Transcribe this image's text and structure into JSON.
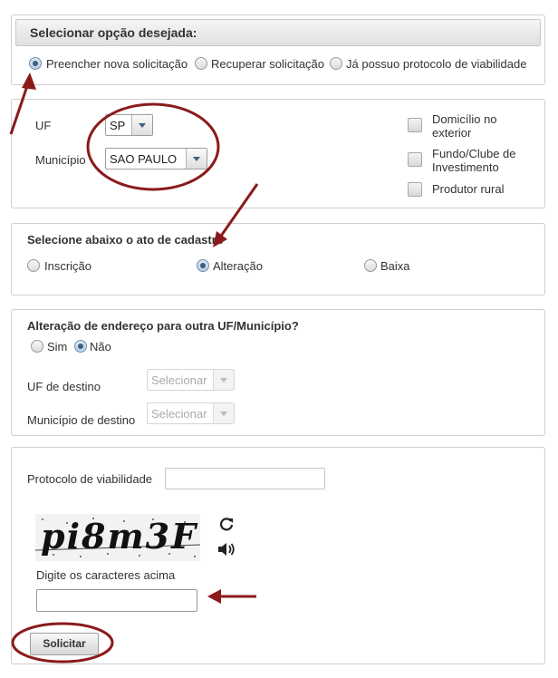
{
  "option_panel": {
    "heading": "Selecionar opção desejada:",
    "options": [
      {
        "label": "Preencher nova solicitação",
        "selected": true
      },
      {
        "label": "Recuperar solicitação",
        "selected": false
      },
      {
        "label": "Já possuo protocolo de viabilidade",
        "selected": false
      }
    ]
  },
  "location_panel": {
    "uf_label": "UF",
    "uf_value": "SP",
    "municipio_label": "Município",
    "municipio_value": "SAO PAULO",
    "checkboxes": [
      {
        "line1": "Domicílio no",
        "line2": "exterior",
        "checked": false
      },
      {
        "line1": "Fundo/Clube de",
        "line2": "Investimento",
        "checked": false
      },
      {
        "line1": "Produtor rural",
        "line2": "",
        "checked": false
      }
    ]
  },
  "act_panel": {
    "heading": "Selecione abaixo o ato de cadastro",
    "options": [
      {
        "label": "Inscrição",
        "selected": false
      },
      {
        "label": "Alteração",
        "selected": true
      },
      {
        "label": "Baixa",
        "selected": false
      }
    ]
  },
  "address_panel": {
    "heading": "Alteração de endereço para outra UF/Município?",
    "options": [
      {
        "label": "Sim",
        "selected": false
      },
      {
        "label": "Não",
        "selected": true
      }
    ],
    "uf_destino_label": "UF de destino",
    "uf_destino_placeholder": "Selecionar",
    "municipio_destino_label": "Município de destino",
    "municipio_destino_placeholder": "Selecionar"
  },
  "protocol_panel": {
    "protocolo_label": "Protocolo de viabilidade",
    "protocolo_value": "",
    "captcha_text": "pi8m3F",
    "captcha_prompt": "Digite os caracteres acima",
    "captcha_value": "",
    "submit_label": "Solicitar"
  },
  "colors": {
    "annotation": "#8b1a1a",
    "radio_selected": "#3d5f82"
  },
  "icons": {
    "refresh": "refresh-icon",
    "audio": "speaker-icon"
  }
}
